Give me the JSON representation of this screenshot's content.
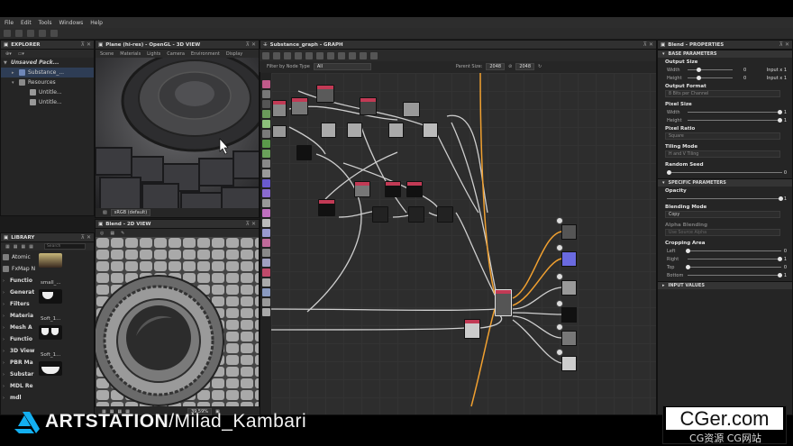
{
  "menu": {
    "items": [
      "File",
      "Edit",
      "Tools",
      "Windows",
      "Help"
    ]
  },
  "explorer": {
    "title": "EXPLORER",
    "package": "Unsaved Pack...",
    "items": [
      "Substance_...",
      "Resources",
      "Untitle...",
      "Untitle..."
    ]
  },
  "view3d": {
    "title": "Plane (hi-res) - OpenGL - 3D VIEW",
    "menu": [
      "Scene",
      "Materials",
      "Lights",
      "Camera",
      "Environment",
      "Display"
    ],
    "colorspace": "sRGB (default)"
  },
  "view2d": {
    "title": "Blend - 2D VIEW",
    "zoom": "39.59%"
  },
  "library": {
    "title": "LIBRARY",
    "search_placeholder": "Search",
    "items": [
      "Atomic",
      "FxMap N",
      "Functio",
      "Generat",
      "Filters",
      "Materia",
      "Mesh A",
      "Functio",
      "3D View",
      "PBR Ma",
      "Substar",
      "MDL Re",
      "mdl"
    ],
    "thumb_labels": [
      "small_...",
      "Soft_1...",
      "Soft_1..."
    ]
  },
  "graph": {
    "title": "Substance_graph - GRAPH",
    "filter_label": "Filter by Node Type",
    "filter_value": "All",
    "parent_size_label": "Parent Size:",
    "size_x": "2048",
    "size_y": "2048"
  },
  "properties": {
    "title": "Blend - PROPERTIES",
    "base_section": "BASE PARAMETERS",
    "output_size": "Output Size",
    "width": "Width",
    "height": "Height",
    "width_val": "0",
    "height_val": "0",
    "input_x1": "Input x 1",
    "input_x1b": "Input x 1",
    "output_format": "Output Format",
    "output_format_val": "8 Bits per Channel",
    "pixel_size": "Pixel Size",
    "pixel_w": "Width",
    "pixel_h": "Height",
    "pixel_w_val": "1",
    "pixel_h_val": "1",
    "pixel_ratio": "Pixel Ratio",
    "pixel_ratio_val": "Square",
    "tiling_mode": "Tiling Mode",
    "tiling_mode_val": "H and V Tiling",
    "random_seed": "Random Seed",
    "random_seed_val": "0",
    "specific_section": "SPECIFIC PARAMETERS",
    "opacity": "Opacity",
    "opacity_val": "1",
    "blending_mode": "Blending Mode",
    "blending_mode_val": "Copy",
    "alpha_blending": "Alpha Blending",
    "alpha_blending_val": "Use Source Alpha",
    "cropping_area": "Cropping Area",
    "left": "Left",
    "right": "Right",
    "top": "Top",
    "bottom": "Bottom",
    "left_val": "0",
    "right_val": "1",
    "top_val": "0",
    "bottom_val": "1",
    "input_values": "INPUT VALUES"
  },
  "watermark": {
    "brand": "ARTSTATION",
    "author": "/Milad_Kambari",
    "cg_main": "CGer.com",
    "cg_sub": "CG资源 CG网站"
  },
  "colors": {
    "accent": "#c23a55",
    "link_orange": "#f0a030",
    "green_label": "#3ce04c"
  }
}
